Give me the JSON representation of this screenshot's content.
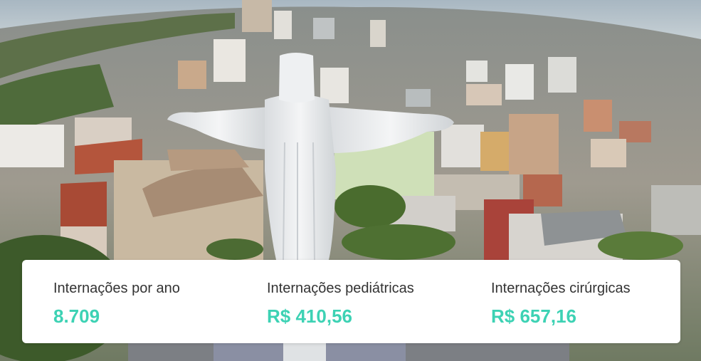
{
  "colors": {
    "accent": "#3dd2b4",
    "label": "#333333",
    "card": "#ffffff"
  },
  "hero": {
    "image": "aerial-city-with-christ-statue"
  },
  "stats": [
    {
      "label": "Internações por ano",
      "value": "8.709"
    },
    {
      "label": "Internações pediátricas",
      "value": "R$ 410,56"
    },
    {
      "label": "Internações cirúrgicas",
      "value": "R$ 657,16"
    }
  ]
}
